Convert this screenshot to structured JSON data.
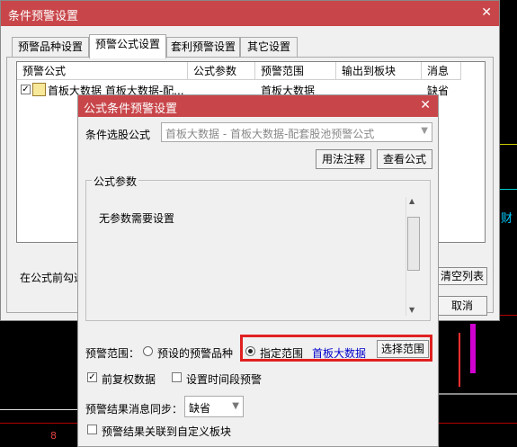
{
  "outer": {
    "title": "条件预警设置",
    "tabs": [
      "预警品种设置",
      "预警公式设置",
      "套利预警设置",
      "其它设置"
    ],
    "active_tab": 1,
    "columns": [
      "预警公式",
      "公式参数",
      "预警范围",
      "输出到板块",
      "消息"
    ],
    "rows": [
      {
        "formula": "首板大数据 首板大数据-配...",
        "params": "",
        "range": "首板大数据",
        "output": "",
        "message": "缺省",
        "checked": true
      }
    ],
    "bottom_hint": "在公式前勾选",
    "clear_list": "清空列表",
    "cancel": "取消"
  },
  "inner": {
    "title": "公式条件预警设置",
    "formula_label": "条件选股公式",
    "formula_value": "首板大数据  -  首板大数据-配套股池预警公式",
    "usage_button": "用法注释",
    "view_button": "查看公式",
    "params_group": "公式参数",
    "params_text": "无参数需要设置",
    "range_label": "预警范围：",
    "range_preset": "预设的预警品种",
    "range_specified": "指定范围",
    "range_value": "首板大数据",
    "select_range_button": "选择范围",
    "fq_checkbox": "前复权数据",
    "fq_checked": true,
    "timeslot_checkbox": "设置时间段预警",
    "timeslot_checked": false,
    "sync_label": "预警结果消息同步：",
    "sync_value": "缺省",
    "link_checkbox": "预警结果关联到自定义板块",
    "link_checked": false
  },
  "background": {
    "labels": [
      "财",
      "8",
      "8"
    ]
  },
  "colors": {
    "title_bar": "#c8464a",
    "highlight_border": "#e02020",
    "range_value": "#0000cc"
  }
}
